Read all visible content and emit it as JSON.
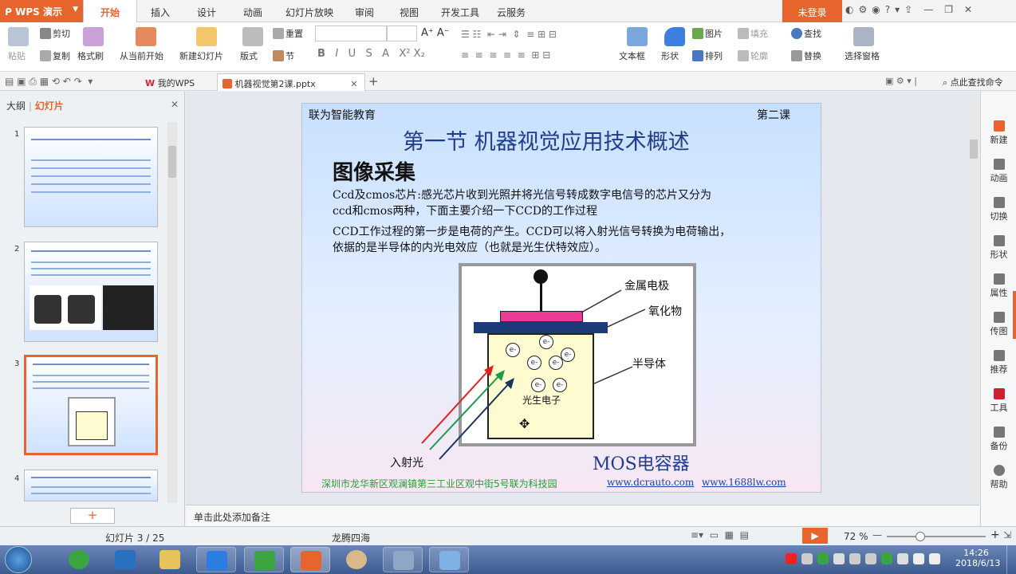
{
  "app": {
    "name": "WPS 演示",
    "login": "未登录"
  },
  "menu": [
    "开始",
    "插入",
    "设计",
    "动画",
    "幻灯片放映",
    "审阅",
    "视图",
    "开发工具",
    "云服务"
  ],
  "ribbon": {
    "paste": "粘贴",
    "cut": "剪切",
    "copy": "复制",
    "format_painter": "格式刷",
    "from_current": "从当前开始",
    "new_slide": "新建幻灯片",
    "layout": "版式",
    "reset": "重置",
    "section": "节",
    "textbox": "文本框",
    "shape": "形状",
    "picture": "图片",
    "arrange": "排列",
    "fill": "填充",
    "outline": "轮廓",
    "find": "查找",
    "replace": "替换",
    "selection_pane": "选择窗格"
  },
  "tabs": {
    "wps": "我的WPS",
    "doc": "机器视觉第2课.pptx",
    "search": "点此查找命令"
  },
  "panel": {
    "outline": "大纲",
    "slides": "幻灯片",
    "thumb_numbers": [
      "1",
      "2",
      "3",
      "4"
    ],
    "add": "+"
  },
  "slide": {
    "header_left": "联为智能教育",
    "header_right": "第二课",
    "title": "第一节   机器视觉应用技术概述",
    "subtitle": "图像采集",
    "para1_line1": "Ccd及cmos芯片:感光芯片收到光照并将光信号转成数字电信号的芯片又分为",
    "para1_line2": "ccd和cmos两种，下面主要介绍一下CCD的工作过程",
    "para2_line1": "CCD工作过程的第一步是电荷的产生。CCD可以将入射光信号转换为电荷输出，",
    "para2_line2": "依据的是半导体的内光电效应（也就是光生伏特效应）。",
    "diagram": {
      "metal": "金属电极",
      "oxide": "氧化物",
      "semi": "半导体",
      "electron": "e-",
      "photo": "光生电子",
      "incident": "入射光",
      "mos": "MOS电容器"
    },
    "footer_addr": "深圳市龙华新区观澜镇第三工业区观中街5号联为科技园",
    "footer_link1": "www.dcrauto.com",
    "footer_link2": "www.1688lw.com"
  },
  "notes": "单击此处添加备注",
  "right_bar": [
    "新建",
    "动画",
    "切换",
    "形状",
    "属性",
    "传图",
    "推荐",
    "工具",
    "备份",
    "帮助"
  ],
  "status": {
    "slide": "幻灯片 3 / 25",
    "theme": "龙腾四海",
    "zoom": "72 %"
  },
  "taskbar": {
    "time": "14:26",
    "date": "2018/6/13"
  },
  "colors": {
    "accent": "#e7652c",
    "slide_title": "#1f3d8a",
    "footer": "#2b9b3a",
    "link": "#1a3fb0"
  }
}
